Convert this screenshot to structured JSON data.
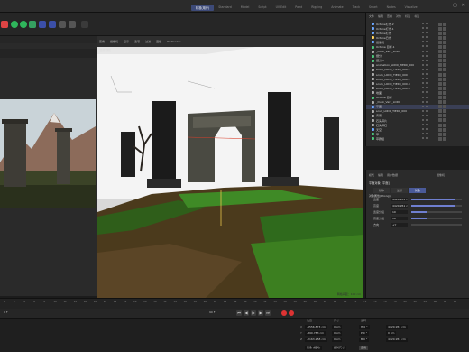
{
  "workspace_tabs": [
    "标准(用户)",
    "Standard",
    "Model",
    "Script",
    "UV Edit",
    "Paint",
    "Rigging",
    "Animate",
    "Track",
    "Smart",
    "Nodes",
    "Visualize"
  ],
  "window_controls": [
    "—",
    "▢",
    "✕"
  ],
  "viewport": {
    "title": "透视视图",
    "menu": [
      "查看",
      "摄像机",
      "显示",
      "选项",
      "过滤",
      "面板",
      "ProRender"
    ],
    "status": "网格间距：100 cm"
  },
  "object_manager": {
    "menu": [
      "文件",
      "编辑",
      "查看",
      "对象",
      "标签",
      "书签"
    ],
    "rows": [
      {
        "label": "Octane灯光.2",
        "color": "#6aa6ff"
      },
      {
        "label": "Octane灯光.1",
        "color": "#6aa6ff"
      },
      {
        "label": "Octane灯光",
        "color": "#6aa6ff"
      },
      {
        "label": "Octane日光",
        "color": "#ffd45e"
      },
      {
        "label": "摄像机",
        "color": "#6aa6ff"
      },
      {
        "label": "Octane 目标.1",
        "color": "#4cc47a"
      },
      {
        "label": "_Dusk_Var1_LOD1",
        "color": "#aaaaaa"
      },
      {
        "label": "细分",
        "color": "#4cc47a"
      },
      {
        "label": "细分.1",
        "color": "#4cc47a"
      },
      {
        "label": "animation_LOD0_TIER0_000",
        "color": "#aaaaaa"
      },
      {
        "label": "sculp_LOD0_TIER0_000.1",
        "color": "#aaaaaa"
      },
      {
        "label": "sculp_LOD0_TIER0_000",
        "color": "#aaaaaa"
      },
      {
        "label": "sculp_LOD0_TIER0_000.2",
        "color": "#aaaaaa"
      },
      {
        "label": "sculp_LOD0_TIER0_000.3",
        "color": "#aaaaaa"
      },
      {
        "label": "sculp_LOD0_TIER0_000.4",
        "color": "#aaaaaa"
      },
      {
        "label": "地面",
        "color": "#aaaaaa"
      },
      {
        "label": "Octane 目标",
        "color": "#4cc47a"
      },
      {
        "label": "_Dusk_Var1_LOD0",
        "color": "#aaaaaa"
      },
      {
        "label": "平面",
        "color": "#6aa6ff"
      },
      {
        "label": "sculf_LOD0_TIER0_000",
        "color": "#aaaaaa"
      },
      {
        "label": "背景",
        "color": "#aaaaaa"
      },
      {
        "label": "石头碎片",
        "color": "#aaaaaa"
      },
      {
        "label": "石头碎石",
        "color": "#aaaaaa"
      },
      {
        "label": "天空",
        "color": "#6aa6ff"
      },
      {
        "label": "草",
        "color": "#4cc47a"
      },
      {
        "label": "草群组",
        "color": "#4cc47a"
      }
    ]
  },
  "attributes": {
    "menu": [
      "模式",
      "编辑",
      "用户数据"
    ],
    "mode_label": "摄像机",
    "object_name": "平面对象 [平面]",
    "tabs": [
      "基本",
      "坐标",
      "对象"
    ],
    "active_tab": 2,
    "section": "对象属性(Phong)",
    "params": [
      {
        "label": "宽度",
        "value": "4420.951 c",
        "fill": 0.85
      },
      {
        "label": "高度",
        "value": "4420.951 c",
        "fill": 0.85
      },
      {
        "label": "宽度分段",
        "value": "10",
        "fill": 0.3
      },
      {
        "label": "高度分段",
        "value": "10",
        "fill": 0.3
      },
      {
        "label": "方向",
        "value": "+Y",
        "fill": 0
      }
    ]
  },
  "timeline": {
    "ticks": [
      "0",
      "2",
      "4",
      "6",
      "8",
      "10",
      "12",
      "14",
      "16",
      "18",
      "20",
      "22",
      "24",
      "26",
      "28",
      "30",
      "32",
      "34",
      "36",
      "38",
      "40",
      "42",
      "44",
      "46",
      "48",
      "50",
      "52",
      "54",
      "56",
      "58",
      "60",
      "62",
      "64",
      "66",
      "68",
      "70",
      "72",
      "74",
      "76",
      "78",
      "80",
      "82",
      "84",
      "86",
      "88",
      "90"
    ],
    "current_frame": "0 F",
    "end_frame": "90 F"
  },
  "coords": {
    "headers": [
      "位置",
      "尺寸",
      "旋转"
    ],
    "rows": [
      {
        "axis": "X",
        "pos": "-6556.873 cm",
        "size": "0 cm",
        "rot": "H 0 °",
        "size_right": "4420.951 cm"
      },
      {
        "axis": "Y",
        "pos": "-890.783 cm",
        "size": "0 cm",
        "rot": "P 0 °",
        "size_right": "0 cm"
      },
      {
        "axis": "Z",
        "pos": "-2163.258 cm",
        "size": "0 cm",
        "rot": "B 0 °",
        "size_right": "4420.951 cm"
      }
    ],
    "dropdowns": [
      "对象 (相对)",
      "绝对尺寸"
    ],
    "apply": "应用"
  },
  "colors": {
    "accent": "#4a5a99",
    "record": "#d33"
  }
}
